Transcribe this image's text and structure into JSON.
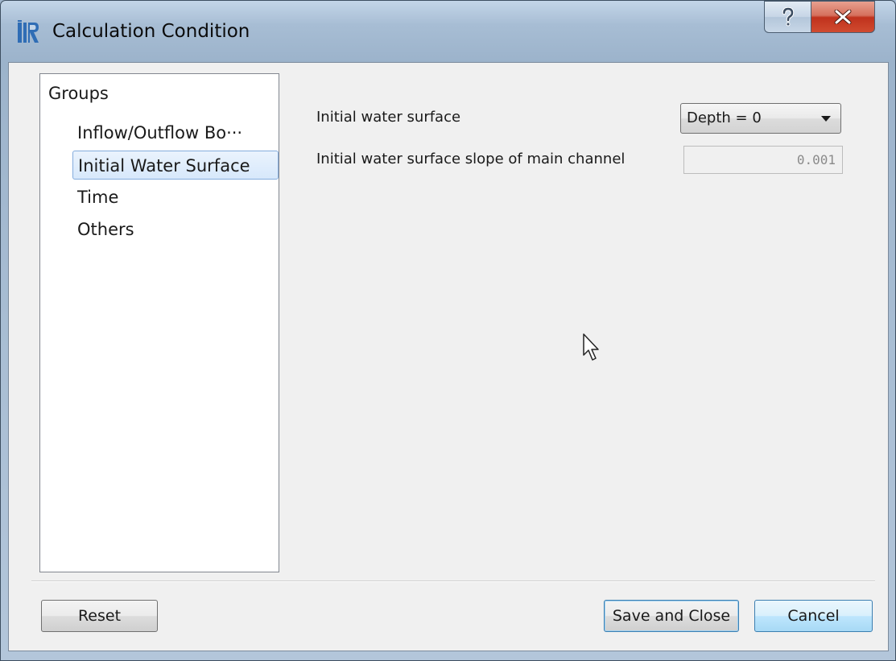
{
  "window": {
    "title": "Calculation Condition",
    "help_icon": "question-mark",
    "close_icon": "x"
  },
  "groups": {
    "header": "Groups",
    "items": [
      {
        "label": "Inflow/Outflow Bo···"
      },
      {
        "label": "Initial Water Surface",
        "selected": true
      },
      {
        "label": "Time"
      },
      {
        "label": "Others"
      }
    ]
  },
  "fields": {
    "initial_water_surface_label": "Initial water surface",
    "initial_water_surface_value": "Depth = 0",
    "slope_label": "Initial water surface slope of main channel",
    "slope_value": "0.001"
  },
  "buttons": {
    "reset": "Reset",
    "save_and_close": "Save and Close",
    "cancel": "Cancel"
  },
  "colors": {
    "selection_fill": "#d7e8fb",
    "selection_border": "#84acdd",
    "close_button": "#c0321d",
    "cancel_hover": "#bee6fd"
  }
}
